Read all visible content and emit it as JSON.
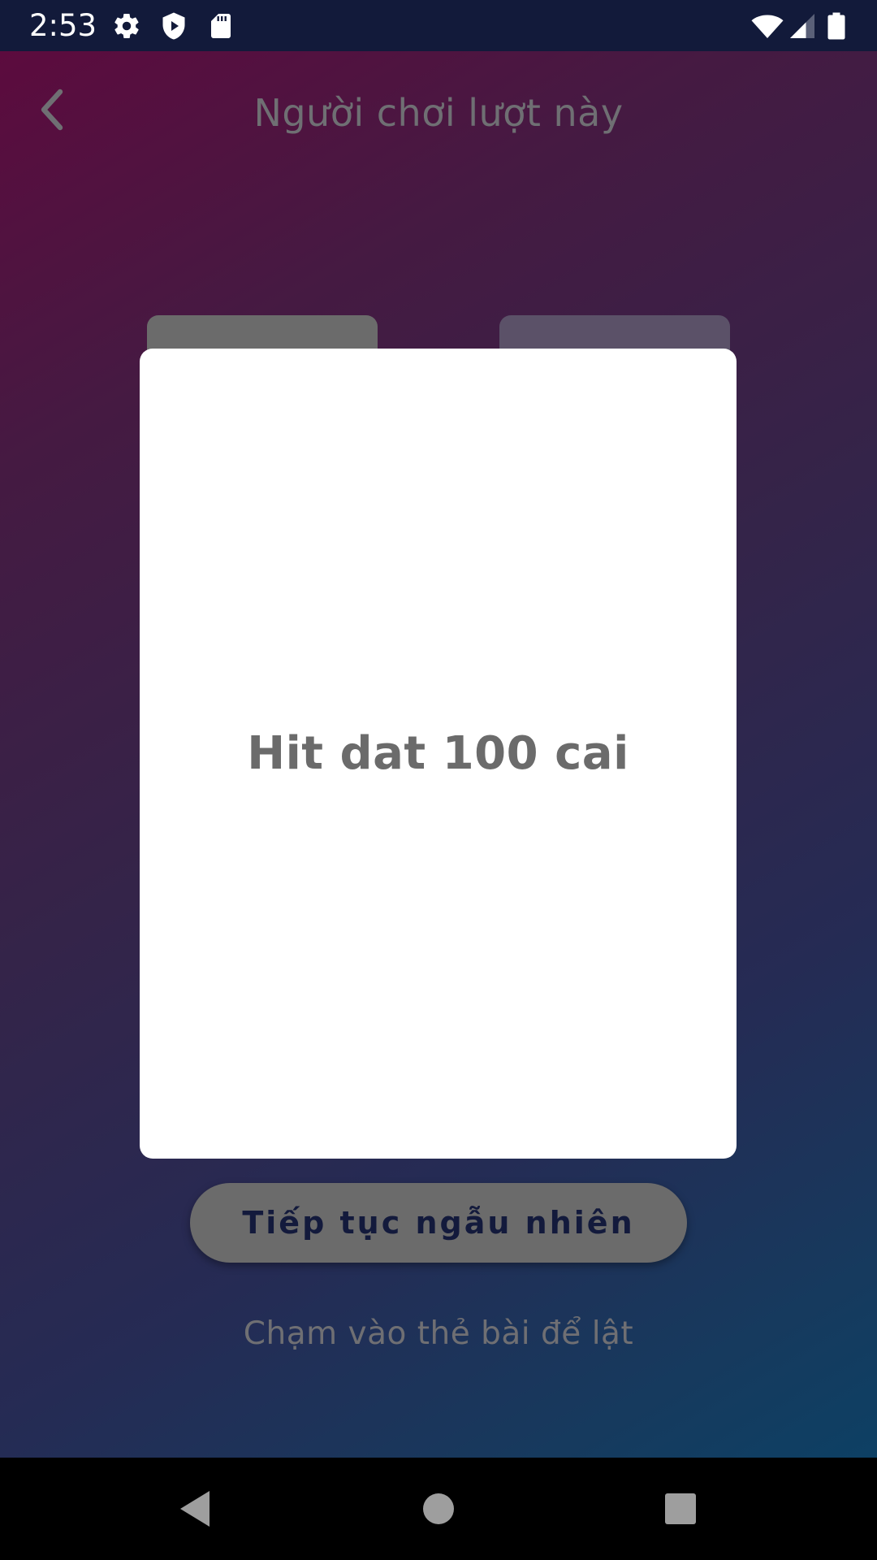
{
  "status_bar": {
    "time": "2:53",
    "icons": [
      "gear-icon",
      "shield-play-icon",
      "sd-card-icon",
      "wifi-icon",
      "signal-icon",
      "battery-icon"
    ]
  },
  "header": {
    "title": "Người chơi lượt này",
    "back_icon": "chevron-left-icon"
  },
  "card": {
    "text": "Hit dat 100 cai"
  },
  "actions": {
    "continue_label": "Tiếp tục ngẫu nhiên",
    "hint": "Chạm vào thẻ bài để lật"
  },
  "nav_bar": {
    "icons": [
      "back-triangle-icon",
      "home-circle-icon",
      "recents-square-icon"
    ]
  },
  "colors": {
    "status_bar_bg": "#121a3a",
    "card_bg": "#ffffff",
    "button_bg": "#6b6b6b",
    "button_text": "#131a3c",
    "muted_text": "#6f6f73"
  }
}
